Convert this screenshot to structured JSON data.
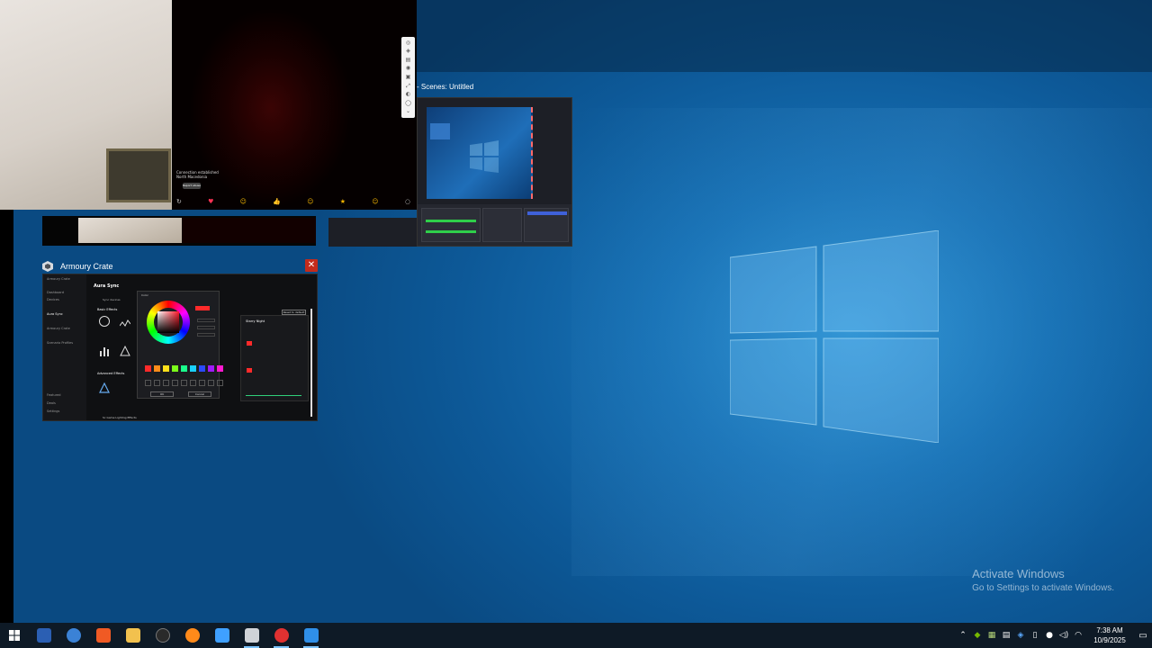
{
  "desktop": {
    "activate_title": "Activate Windows",
    "activate_sub": "Go to Settings to activate Windows."
  },
  "camera": {
    "message_1": "Connection established",
    "message_2": "North Macedonia",
    "button": "Report abuse",
    "reactions": [
      "↻",
      "♥",
      "☺",
      "👍",
      "☺",
      "★",
      "☺",
      "◌"
    ]
  },
  "obs": {
    "title": "- Scenes: Untitled"
  },
  "armoury": {
    "title": "Armoury Crate",
    "heading": "Aura Sync",
    "sub": "Sync devices",
    "effects_heading": "Basic Effects",
    "advanced_heading": "Advanced Effects",
    "sidebar": [
      "Armoury Crate",
      "Dashboard",
      "Devices",
      "Aura Sync",
      "Armoury Crate",
      "Scenario Profiles",
      "Featured",
      "Deals",
      "Settings"
    ],
    "reset": "Reset to default",
    "right_heading": "Starry Night",
    "footer": "Sc Game Lighting Effects",
    "ok": "OK",
    "cancel": "Cancel",
    "picker_title": "Color",
    "swatches": [
      "#ff2a2a",
      "#ff8c1a",
      "#ffe01a",
      "#7cff1a",
      "#1aff8c",
      "#1ad0ff",
      "#2a4aff",
      "#a01aff",
      "#ff1ad0"
    ]
  },
  "taskbar": {
    "time": "7:38 AM",
    "date": "10/9/2025",
    "apps": [
      {
        "name": "start",
        "color": "#ffffff"
      },
      {
        "name": "powershell",
        "color": "#2b5fb3"
      },
      {
        "name": "chrome",
        "color": "#3b82d6"
      },
      {
        "name": "brave",
        "color": "#f05a24"
      },
      {
        "name": "file-explorer",
        "color": "#f2c14e"
      },
      {
        "name": "obs",
        "color": "#2a2a2a"
      },
      {
        "name": "firefox",
        "color": "#ff8a1a"
      },
      {
        "name": "aura-creator",
        "color": "#3fa0ff"
      },
      {
        "name": "armoury-crate",
        "color": "#cfd3d8"
      },
      {
        "name": "recorder",
        "color": "#e03131"
      },
      {
        "name": "taskbar-app-blue",
        "color": "#2f8fe8"
      }
    ]
  }
}
